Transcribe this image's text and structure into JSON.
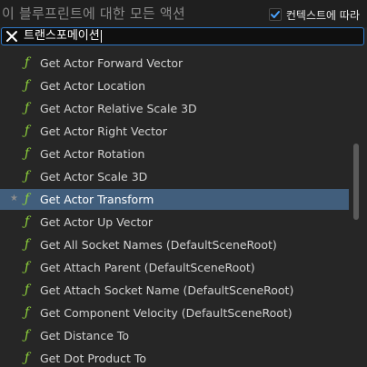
{
  "header": {
    "title": "이 블루프린트에 대한 모든 액션",
    "context_sensitive": {
      "label": "컨텍스트에 따라",
      "checked": true
    }
  },
  "search": {
    "value": "트랜스포메이션"
  },
  "actions": [
    {
      "label": "Get Actor Forward Vector",
      "icon": "function-icon"
    },
    {
      "label": "Get Actor Location",
      "icon": "function-icon"
    },
    {
      "label": "Get Actor Relative Scale 3D",
      "icon": "function-icon"
    },
    {
      "label": "Get Actor Right Vector",
      "icon": "function-icon"
    },
    {
      "label": "Get Actor Rotation",
      "icon": "function-icon"
    },
    {
      "label": "Get Actor Scale 3D",
      "icon": "function-icon"
    },
    {
      "label": "Get Actor Transform",
      "icon": "function-icon",
      "selected": true,
      "favorite_icon": "star-icon"
    },
    {
      "label": "Get Actor Up Vector",
      "icon": "function-icon"
    },
    {
      "label": "Get All Socket Names (DefaultSceneRoot)",
      "icon": "function-icon"
    },
    {
      "label": "Get Attach Parent (DefaultSceneRoot)",
      "icon": "function-icon"
    },
    {
      "label": "Get Attach Socket Name (DefaultSceneRoot)",
      "icon": "function-icon"
    },
    {
      "label": "Get Component Velocity (DefaultSceneRoot)",
      "icon": "function-icon"
    },
    {
      "label": "Get Distance To",
      "icon": "function-icon"
    },
    {
      "label": "Get Dot Product To",
      "icon": "function-icon"
    }
  ],
  "colors": {
    "function_icon": "#8ed13b",
    "selection": "#415e7c",
    "search_border": "#2f79c9",
    "checkbox_check": "#4aa3ff"
  }
}
